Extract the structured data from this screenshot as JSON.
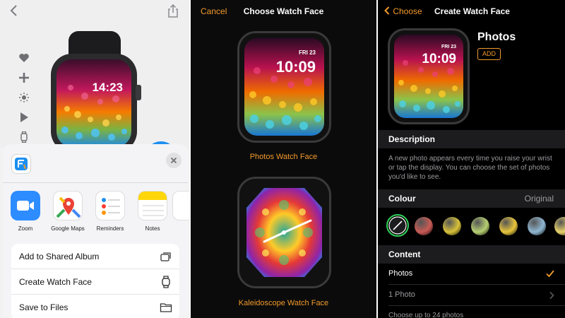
{
  "panel1": {
    "watch": {
      "time": "14:23"
    },
    "share_sheet": {
      "apps": [
        {
          "label": "Zoom",
          "icon": "zoom-icon",
          "color": "#2d8cff"
        },
        {
          "label": "Google Maps",
          "icon": "google-maps-icon",
          "color": "#ffffff"
        },
        {
          "label": "Reminders",
          "icon": "reminders-icon",
          "color": "#ffffff"
        },
        {
          "label": "Notes",
          "icon": "notes-icon",
          "color": "#ffd60a"
        }
      ],
      "actions": [
        {
          "label": "Add to Shared Album",
          "icon": "shared-album-icon"
        },
        {
          "label": "Create Watch Face",
          "icon": "watch-icon"
        },
        {
          "label": "Save to Files",
          "icon": "folder-icon"
        }
      ]
    }
  },
  "panel2": {
    "cancel": "Cancel",
    "title": "Choose Watch Face",
    "face1": {
      "date": "FRI 23",
      "time": "10:09",
      "caption": "Photos Watch Face"
    },
    "face2": {
      "caption": "Kaleidoscope Watch Face"
    }
  },
  "panel3": {
    "back": "Choose",
    "title": "Create Watch Face",
    "face_name": "Photos",
    "add": "ADD",
    "preview": {
      "date": "FRI 23",
      "time": "10:09"
    },
    "description": {
      "heading": "Description",
      "text": "A new photo appears every time you raise your wrist or tap the display. You can choose the set of photos you'd like to see."
    },
    "colour": {
      "heading": "Colour",
      "value": "Original",
      "swatches": [
        "#c95a55",
        "#d8c23a",
        "#b7cf72",
        "#e8c53c",
        "#8fb7d2",
        "#e8d26a"
      ]
    },
    "content": {
      "heading": "Content",
      "rows": [
        {
          "label": "Photos",
          "checked": true
        },
        {
          "label": "1 Photo"
        }
      ],
      "hint": "Choose up to 24 photos"
    },
    "accent": "#f39a2b"
  }
}
